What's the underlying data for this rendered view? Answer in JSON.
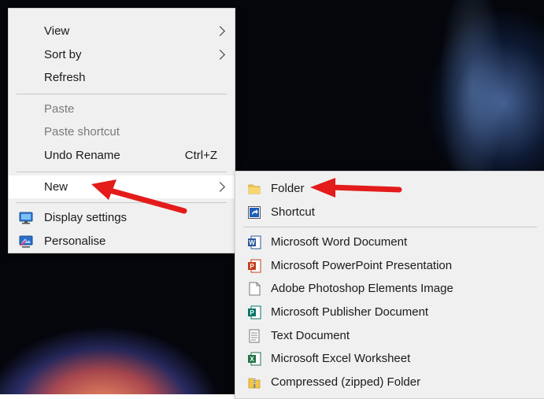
{
  "main_menu": {
    "items": [
      {
        "label": "View"
      },
      {
        "label": "Sort by"
      },
      {
        "label": "Refresh"
      },
      {
        "label": "Paste"
      },
      {
        "label": "Paste shortcut"
      },
      {
        "label": "Undo Rename",
        "shortcut": "Ctrl+Z"
      },
      {
        "label": "New"
      },
      {
        "label": "Display settings",
        "icon": "display-icon"
      },
      {
        "label": "Personalise",
        "icon": "personalise-icon"
      }
    ]
  },
  "new_submenu": {
    "items": [
      {
        "label": "Folder",
        "icon": "folder-icon"
      },
      {
        "label": "Shortcut",
        "icon": "shortcut-icon"
      },
      {
        "label": "Microsoft Word Document",
        "icon": "word-icon"
      },
      {
        "label": "Microsoft PowerPoint Presentation",
        "icon": "powerpoint-icon"
      },
      {
        "label": "Adobe Photoshop Elements Image",
        "icon": "blank-document-icon"
      },
      {
        "label": "Microsoft Publisher Document",
        "icon": "publisher-icon"
      },
      {
        "label": "Text Document",
        "icon": "text-document-icon"
      },
      {
        "label": "Microsoft Excel Worksheet",
        "icon": "excel-icon"
      },
      {
        "label": "Compressed (zipped) Folder",
        "icon": "zip-folder-icon"
      }
    ]
  },
  "colors": {
    "menu_background": "#f0f0f0",
    "highlight": "#ffffff",
    "annotation_arrow": "#e31b1b"
  }
}
